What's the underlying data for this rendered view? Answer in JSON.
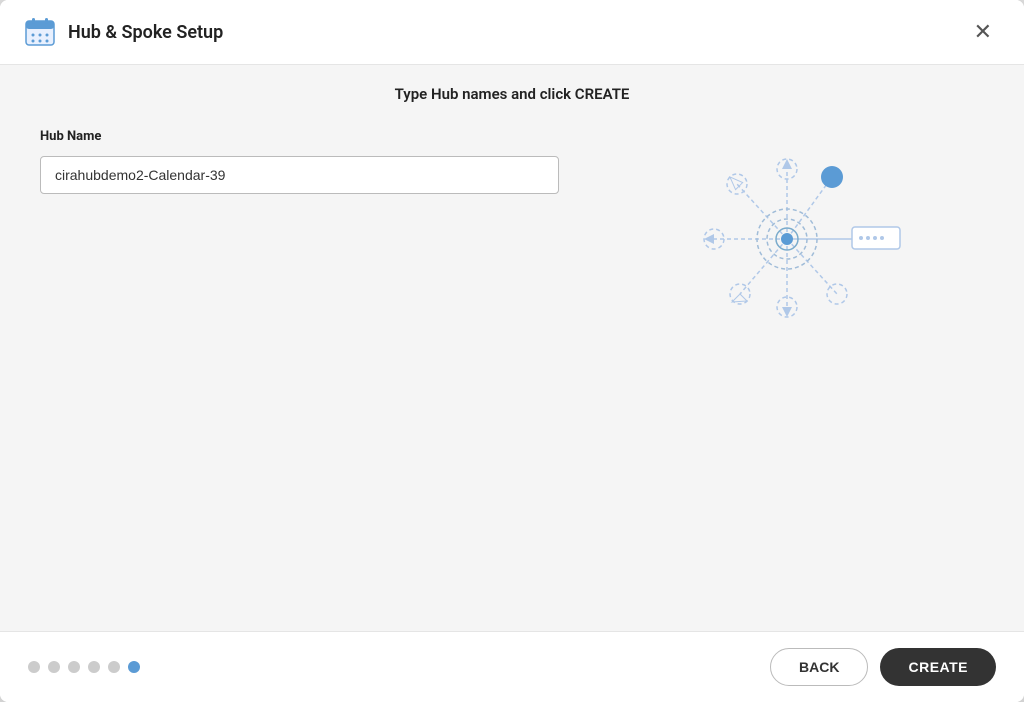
{
  "dialog": {
    "title": "Hub & Spoke Setup",
    "close_icon": "×",
    "instruction": "Type Hub names and click CREATE"
  },
  "form": {
    "hub_name_label": "Hub Name",
    "hub_name_value": "cirahubdemo2-Calendar-39",
    "hub_name_placeholder": "Hub Name"
  },
  "pagination": {
    "dots": [
      false,
      false,
      false,
      false,
      false,
      true
    ],
    "active_index": 5
  },
  "footer": {
    "back_label": "BACK",
    "create_label": "CREATE"
  },
  "icons": {
    "calendar": "📅",
    "close": "✕"
  }
}
